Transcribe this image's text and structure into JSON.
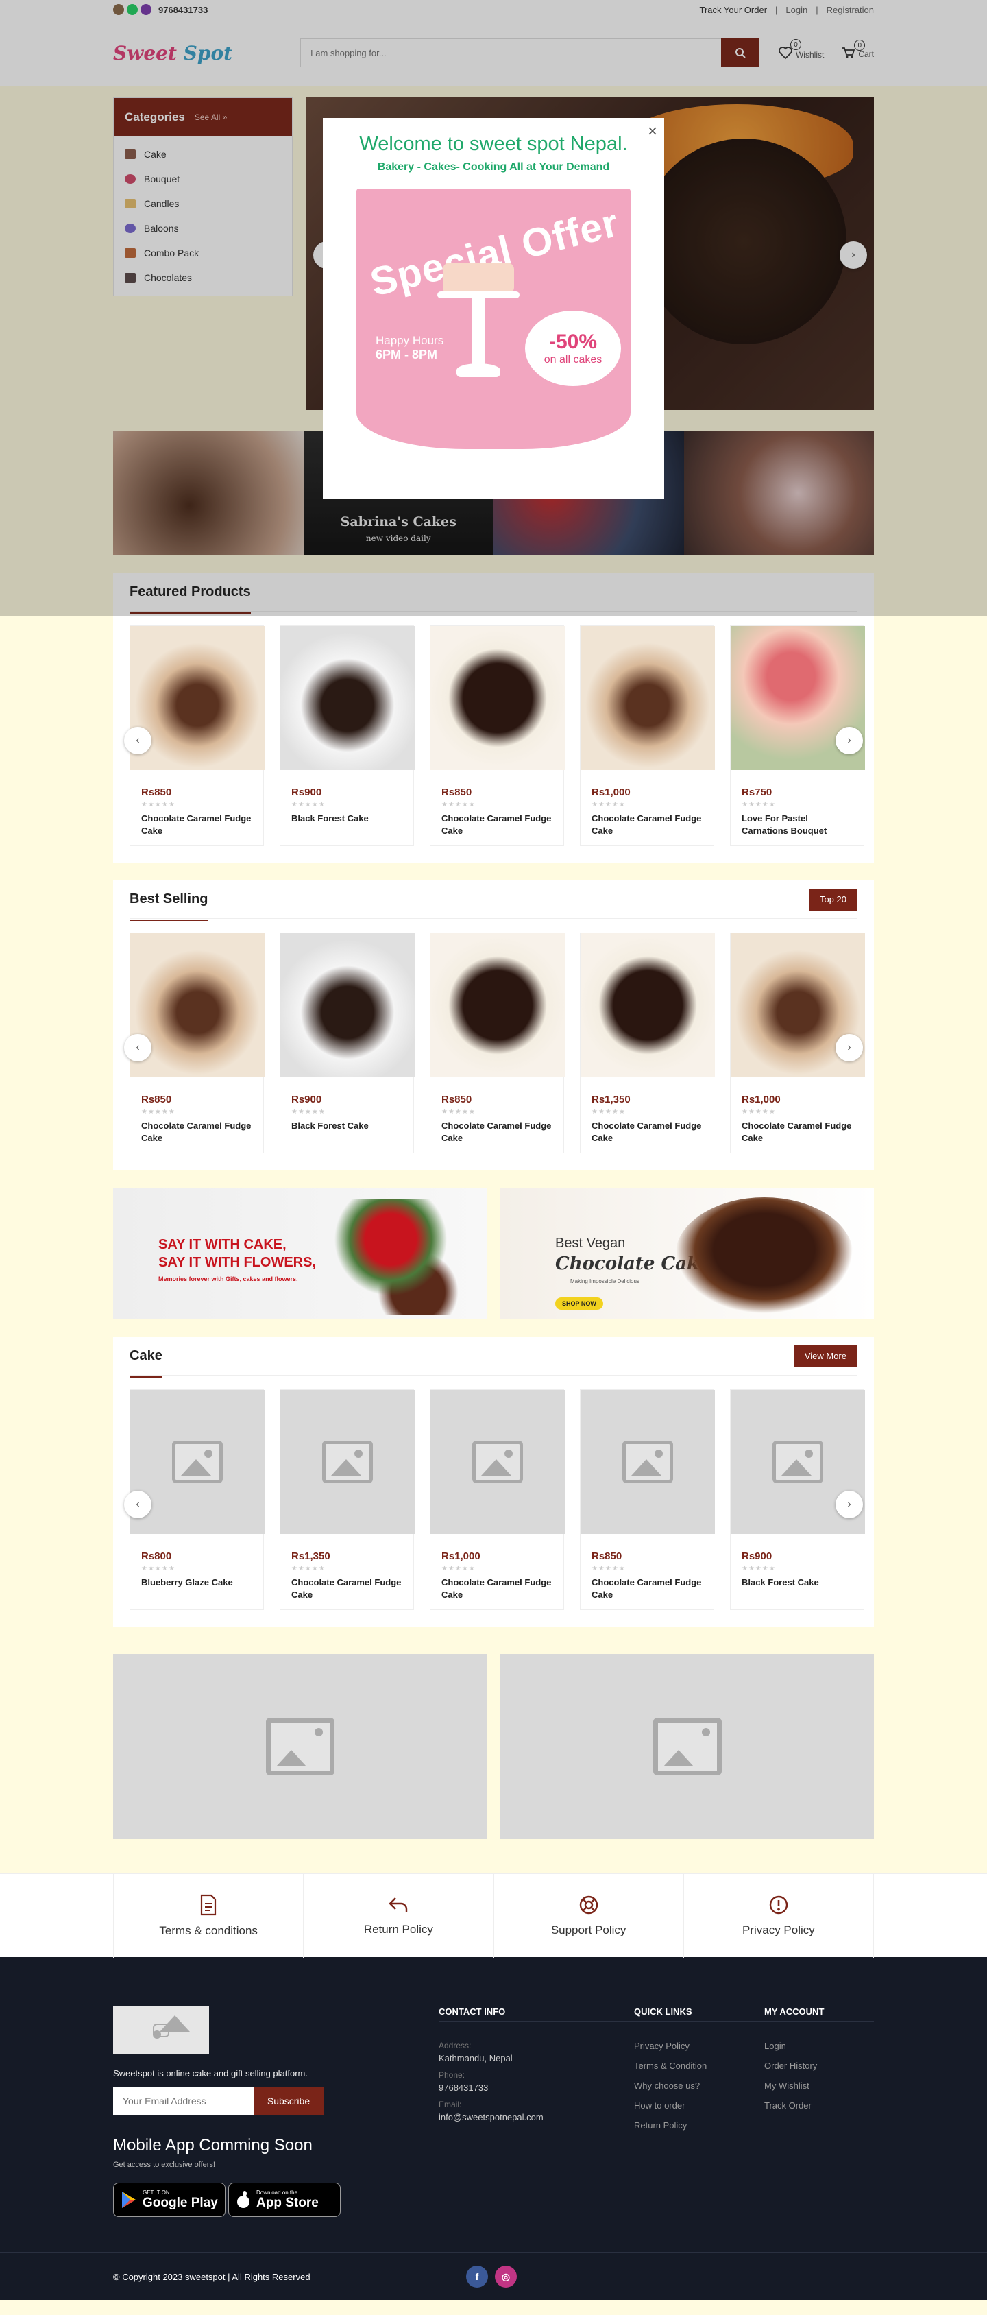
{
  "topbar": {
    "phone": "9768431733",
    "track": "Track Your Order",
    "login": "Login",
    "register": "Registration"
  },
  "header": {
    "logo_a": "Sweet",
    "logo_b": "Spot",
    "search_placeholder": "I am shopping for...",
    "wishlist_label": "Wishlist",
    "wishlist_count": "0",
    "cart_label": "Cart",
    "cart_count": "0"
  },
  "categories": {
    "title": "Categories",
    "see_all": "See All »",
    "items": [
      "Cake",
      "Bouquet",
      "Candles",
      "Baloons",
      "Combo Pack",
      "Chocolates"
    ]
  },
  "banner": {
    "title": "Sabrina's Cakes",
    "subtitle": "new video daily"
  },
  "featured": {
    "title": "Featured Products",
    "items": [
      {
        "price": "Rs850",
        "name": "Chocolate Caramel Fudge Cake"
      },
      {
        "price": "Rs900",
        "name": "Black Forest Cake"
      },
      {
        "price": "Rs850",
        "name": "Chocolate Caramel Fudge Cake"
      },
      {
        "price": "Rs1,000",
        "name": "Chocolate Caramel Fudge Cake"
      },
      {
        "price": "Rs750",
        "name": "Love For Pastel Carnations Bouquet"
      }
    ]
  },
  "best": {
    "title": "Best Selling",
    "button": "Top 20",
    "items": [
      {
        "price": "Rs850",
        "name": "Chocolate Caramel Fudge Cake"
      },
      {
        "price": "Rs900",
        "name": "Black Forest Cake"
      },
      {
        "price": "Rs850",
        "name": "Chocolate Caramel Fudge Cake"
      },
      {
        "price": "Rs1,350",
        "name": "Chocolate Caramel Fudge Cake"
      },
      {
        "price": "Rs1,000",
        "name": "Chocolate Caramel Fudge Cake"
      }
    ]
  },
  "promo": {
    "left_h1": "SAY IT WITH CAKE,",
    "left_h2": "SAY IT WITH FLOWERS,",
    "left_sub": "Memories forever with Gifts, cakes and flowers.",
    "right_h1": "Best Vegan",
    "right_h2": "Chocolate Cake",
    "right_h3": "Making Impossible Delicious",
    "right_btn": "SHOP NOW"
  },
  "cake": {
    "title": "Cake",
    "button": "View More",
    "items": [
      {
        "price": "Rs800",
        "name": "Blueberry Glaze Cake"
      },
      {
        "price": "Rs1,350",
        "name": "Chocolate Caramel Fudge Cake"
      },
      {
        "price": "Rs1,000",
        "name": "Chocolate Caramel Fudge Cake"
      },
      {
        "price": "Rs850",
        "name": "Chocolate Caramel Fudge Cake"
      },
      {
        "price": "Rs900",
        "name": "Black Forest Cake"
      }
    ]
  },
  "policies": [
    "Terms & conditions",
    "Return Policy",
    "Support Policy",
    "Privacy Policy"
  ],
  "footer": {
    "desc": "Sweetspot is online cake and gift selling platform.",
    "email_placeholder": "Your Email Address",
    "subscribe": "Subscribe",
    "app_title": "Mobile App Comming Soon",
    "app_sub": "Get access to exclusive offers!",
    "google_l1": "GET IT ON",
    "google_l2": "Google Play",
    "apple_l1": "Download on the",
    "apple_l2": "App Store",
    "contact_title": "CONTACT INFO",
    "address_label": "Address:",
    "address": "Kathmandu, Nepal",
    "phone_label": "Phone:",
    "phone": "9768431733",
    "email_label": "Email:",
    "email": "info@sweetspotnepal.com",
    "quick_title": "QUICK LINKS",
    "quick": [
      "Privacy Policy",
      "Terms & Condition",
      "Why choose us?",
      "How to order",
      "Return Policy"
    ],
    "account_title": "MY ACCOUNT",
    "account": [
      "Login",
      "Order History",
      "My Wishlist",
      "Track Order"
    ],
    "copyright": "© Copyright 2023 sweetspot  | All Rights Reserved"
  },
  "modal": {
    "title": "Welcome to sweet spot Nepal.",
    "subtitle": "Bakery - Cakes- Cooking All at Your Demand",
    "offer": "Special Offer",
    "hours_l1": "Happy Hours",
    "hours_l2": "6PM - 8PM",
    "discount": "-50%",
    "discount_sub": "on all cakes",
    "close": "×"
  },
  "colors": {
    "brand": "#7a2418",
    "accent_green": "#1fa86a",
    "footer_bg": "#151a26",
    "page_bg": "#fffbe0"
  }
}
